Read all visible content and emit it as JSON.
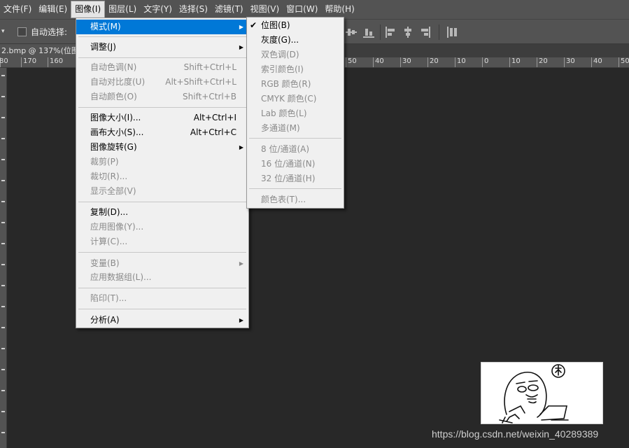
{
  "menubar": {
    "items": [
      {
        "label": "文件(F)"
      },
      {
        "label": "编辑(E)"
      },
      {
        "label": "图像(I)",
        "active": true
      },
      {
        "label": "图层(L)"
      },
      {
        "label": "文字(Y)"
      },
      {
        "label": "选择(S)"
      },
      {
        "label": "滤镜(T)"
      },
      {
        "label": "视图(V)"
      },
      {
        "label": "窗口(W)"
      },
      {
        "label": "帮助(H)"
      }
    ]
  },
  "options_bar": {
    "auto_select_label": "自动选择:"
  },
  "document": {
    "tab_title": "2.bmp @ 137%(位图"
  },
  "ruler": {
    "labels": [
      "80",
      "170",
      "160",
      "50",
      "40",
      "30",
      "20",
      "10",
      "0",
      "10",
      "20",
      "30",
      "40",
      "50"
    ]
  },
  "image_menu": {
    "items": [
      {
        "label": "模式(M)",
        "submenu": true,
        "highlighted": true
      },
      {
        "separator": true
      },
      {
        "label": "调整(J)",
        "submenu": true
      },
      {
        "separator": true
      },
      {
        "label": "自动色调(N)",
        "shortcut": "Shift+Ctrl+L",
        "disabled": true
      },
      {
        "label": "自动对比度(U)",
        "shortcut": "Alt+Shift+Ctrl+L",
        "disabled": true
      },
      {
        "label": "自动颜色(O)",
        "shortcut": "Shift+Ctrl+B",
        "disabled": true
      },
      {
        "separator": true
      },
      {
        "label": "图像大小(I)...",
        "shortcut": "Alt+Ctrl+I"
      },
      {
        "label": "画布大小(S)...",
        "shortcut": "Alt+Ctrl+C"
      },
      {
        "label": "图像旋转(G)",
        "submenu": true
      },
      {
        "label": "裁剪(P)",
        "disabled": true
      },
      {
        "label": "裁切(R)...",
        "disabled": true
      },
      {
        "label": "显示全部(V)",
        "disabled": true
      },
      {
        "separator": true
      },
      {
        "label": "复制(D)..."
      },
      {
        "label": "应用图像(Y)...",
        "disabled": true
      },
      {
        "label": "计算(C)...",
        "disabled": true
      },
      {
        "separator": true
      },
      {
        "label": "变量(B)",
        "submenu": true,
        "disabled": true
      },
      {
        "label": "应用数据组(L)...",
        "disabled": true
      },
      {
        "separator": true
      },
      {
        "label": "陷印(T)...",
        "disabled": true
      },
      {
        "separator": true
      },
      {
        "label": "分析(A)",
        "submenu": true
      }
    ]
  },
  "mode_submenu": {
    "items": [
      {
        "label": "位图(B)",
        "checked": true
      },
      {
        "label": "灰度(G)..."
      },
      {
        "label": "双色调(D)",
        "disabled": true
      },
      {
        "label": "索引颜色(I)",
        "disabled": true
      },
      {
        "label": "RGB 颜色(R)",
        "disabled": true
      },
      {
        "label": "CMYK 颜色(C)",
        "disabled": true
      },
      {
        "label": "Lab 颜色(L)",
        "disabled": true
      },
      {
        "label": "多通道(M)",
        "disabled": true
      },
      {
        "separator": true
      },
      {
        "label": "8 位/通道(A)",
        "disabled": true
      },
      {
        "label": "16 位/通道(N)",
        "disabled": true
      },
      {
        "label": "32 位/通道(H)",
        "disabled": true
      },
      {
        "separator": true
      },
      {
        "label": "颜色表(T)...",
        "disabled": true
      }
    ]
  },
  "watermark": {
    "text": "https://blog.csdn.net/weixin_40289389"
  },
  "colors": {
    "app_bg": "#282828",
    "panel": "#535353",
    "menu_bg": "#f0f0f0",
    "highlight": "#0078d7"
  }
}
